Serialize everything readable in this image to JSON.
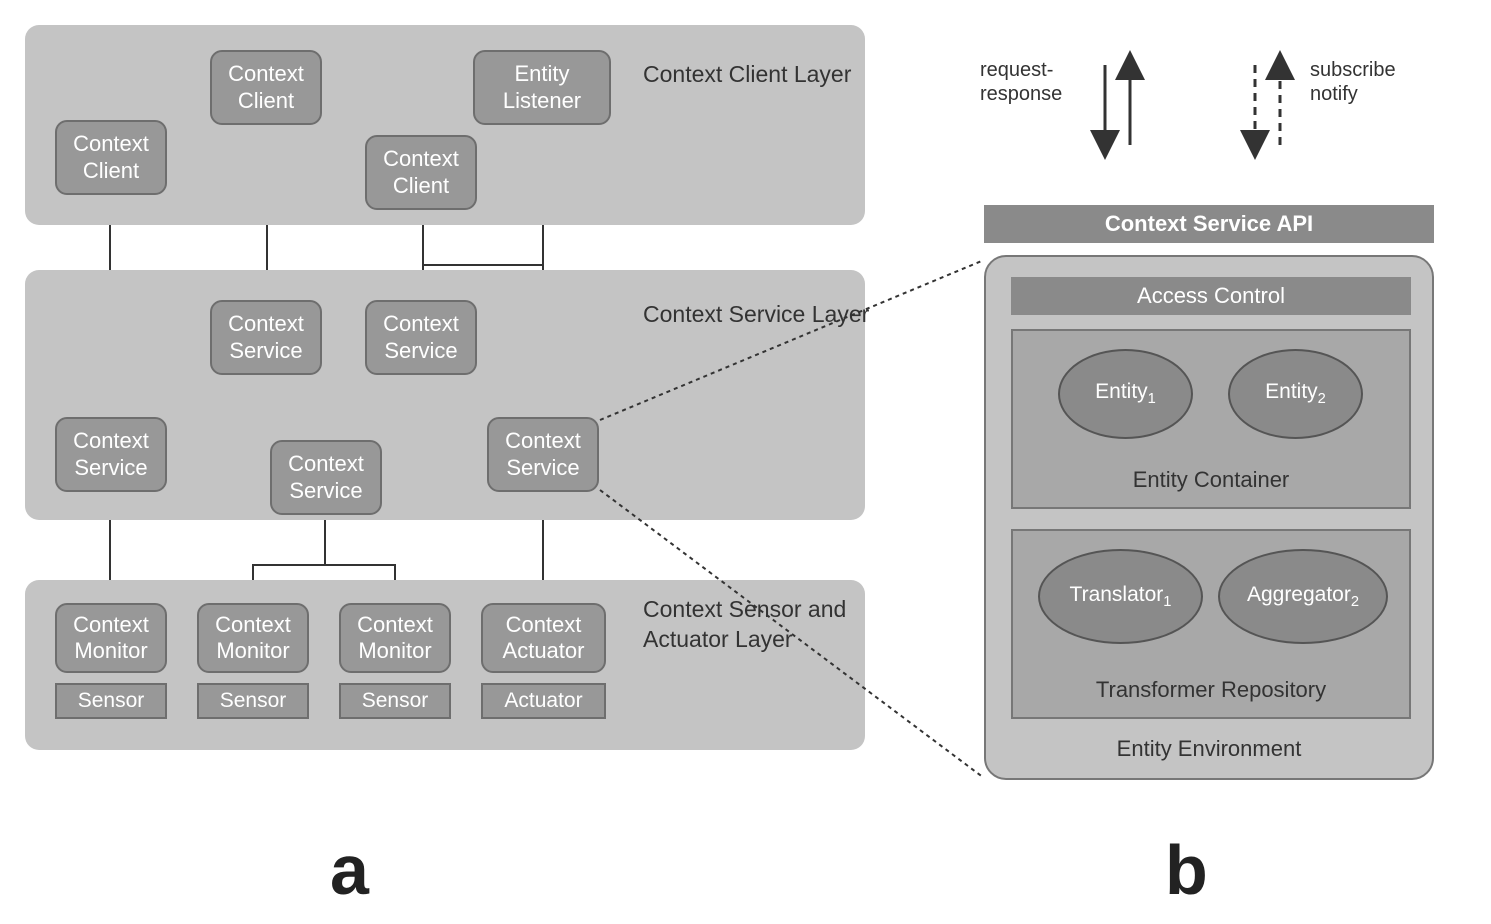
{
  "panel_a": {
    "layers": {
      "client": "Context Client Layer",
      "service": "Context Service Layer",
      "sensor": "Context Sensor and Actuator Layer"
    },
    "nodes": {
      "client1": "Context Client",
      "client2": "Context Client",
      "client3": "Context Client",
      "entity_listener": "Entity Listener",
      "service1": "Context Service",
      "service2": "Context Service",
      "service3": "Context Service",
      "service4": "Context Service",
      "service5": "Context Service",
      "monitor1": "Context Monitor",
      "monitor2": "Context Monitor",
      "monitor3": "Context Monitor",
      "actuator_ctrl": "Context Actuator",
      "sensor1": "Sensor",
      "sensor2": "Sensor",
      "sensor3": "Sensor",
      "actuator": "Actuator"
    },
    "letter": "a"
  },
  "panel_b": {
    "arrows": {
      "req_resp": "request-\nresponse",
      "sub_notify": "subscribe\nnotify"
    },
    "api_bar": "Context Service API",
    "env_title": "Entity Environment",
    "access": "Access Control",
    "entity_container": {
      "title": "Entity Container",
      "e1": "Entity",
      "e1_sub": "1",
      "e2": "Entity",
      "e2_sub": "2"
    },
    "transformer_repo": {
      "title": "Transformer Repository",
      "t1": "Translator",
      "t1_sub": "1",
      "t2": "Aggregator",
      "t2_sub": "2"
    },
    "letter": "b"
  }
}
